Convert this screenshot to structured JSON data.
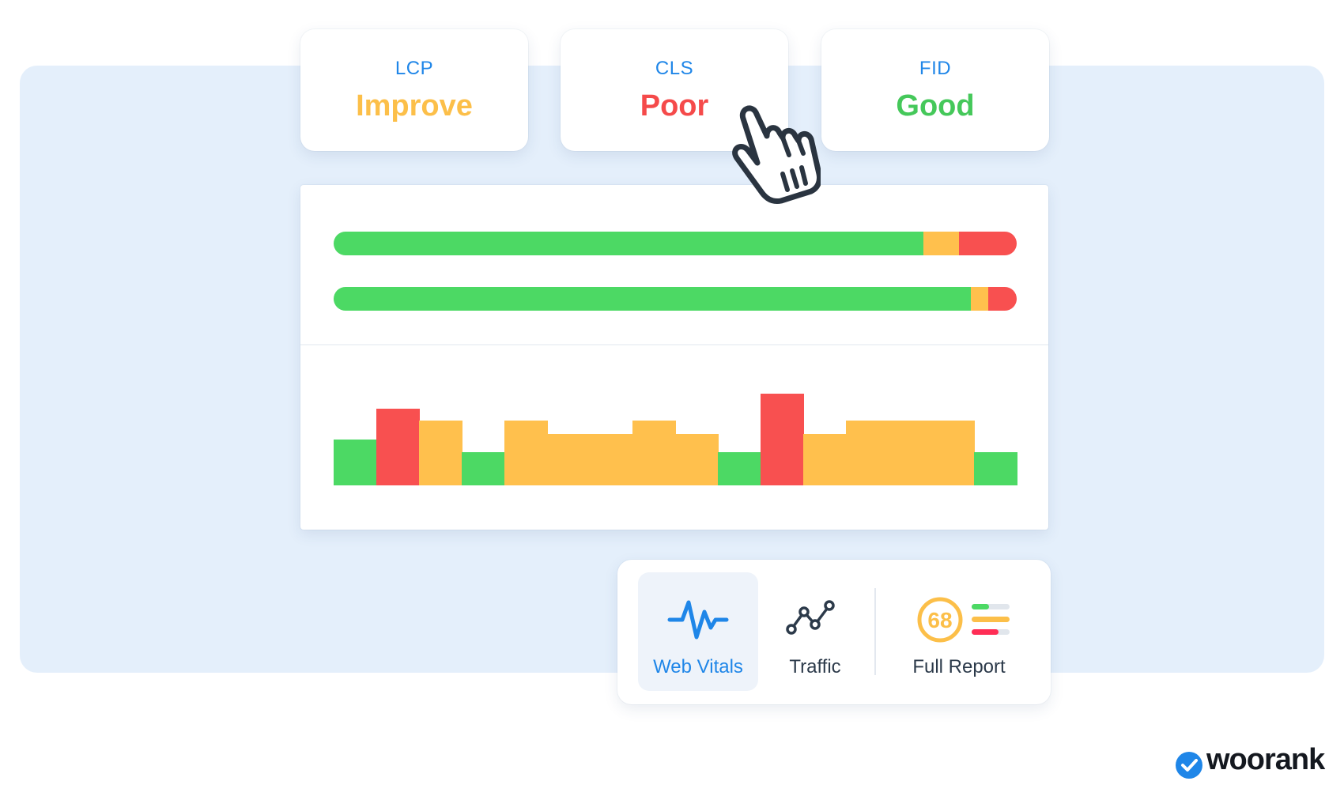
{
  "colors": {
    "good": "#4cd964",
    "improve": "#ffc04d",
    "poor": "#f85050",
    "accent": "#1f86e8",
    "backdrop": "#e4effb"
  },
  "metrics": [
    {
      "name": "LCP",
      "status": "Improve",
      "status_color": "#fcbf49"
    },
    {
      "name": "CLS",
      "status": "Poor",
      "status_color": "#f54a4a"
    },
    {
      "name": "FID",
      "status": "Good",
      "status_color": "#45c85a"
    }
  ],
  "distribution_bars": [
    [
      {
        "level": "good",
        "fraction": 0.864
      },
      {
        "level": "improve",
        "fraction": 0.051
      },
      {
        "level": "poor",
        "fraction": 0.085
      }
    ],
    [
      {
        "level": "good",
        "fraction": 0.933
      },
      {
        "level": "improve",
        "fraction": 0.025
      },
      {
        "level": "poor",
        "fraction": 0.042
      }
    ]
  ],
  "histogram": [
    {
      "level": "good",
      "value": 45
    },
    {
      "level": "poor",
      "value": 75
    },
    {
      "level": "improve",
      "value": 63
    },
    {
      "level": "good",
      "value": 32
    },
    {
      "level": "improve",
      "value": 63
    },
    {
      "level": "improve",
      "value": 50
    },
    {
      "level": "improve",
      "value": 50
    },
    {
      "level": "improve",
      "value": 63
    },
    {
      "level": "improve",
      "value": 50
    },
    {
      "level": "good",
      "value": 32
    },
    {
      "level": "poor",
      "value": 89
    },
    {
      "level": "improve",
      "value": 50
    },
    {
      "level": "improve",
      "value": 63
    },
    {
      "level": "improve",
      "value": 63
    },
    {
      "level": "improve",
      "value": 63
    },
    {
      "level": "good",
      "value": 32
    }
  ],
  "nav": {
    "web_vitals_label": "Web Vitals",
    "traffic_label": "Traffic",
    "full_report_label": "Full Report",
    "score": "68",
    "active": "web_vitals"
  },
  "icons": {
    "web_vitals": "pulse-icon",
    "traffic": "line-graph-icon",
    "full_report": "score-report-icon",
    "cursor": "hand-pointer-icon",
    "brand": "checkmark-badge-icon"
  },
  "brand": {
    "name": "woorank"
  }
}
